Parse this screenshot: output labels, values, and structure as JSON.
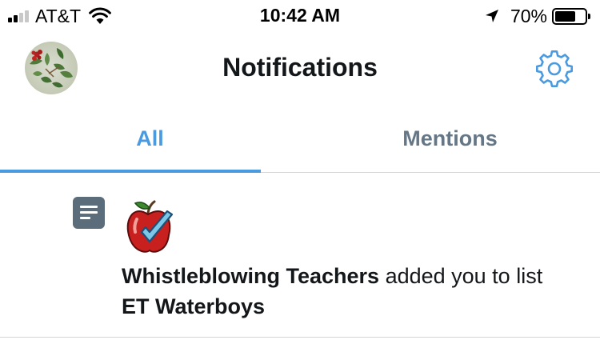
{
  "status_bar": {
    "carrier": "AT&T",
    "time": "10:42 AM",
    "battery_percent": "70%",
    "battery_level": 0.7,
    "signal_bars": 4,
    "signal_bars_filled": 2
  },
  "header": {
    "title": "Notifications",
    "settings_icon": "gear-icon",
    "accent_color": "#4a9ae0"
  },
  "tabs": [
    {
      "label": "All",
      "active": true
    },
    {
      "label": "Mentions",
      "active": false
    }
  ],
  "notification": {
    "type_icon": "list-icon",
    "avatar_icon": "apple-check-icon",
    "actor": "Whistleblowing Teachers",
    "action": " added you to list ",
    "list_name": "ET Waterboys"
  }
}
